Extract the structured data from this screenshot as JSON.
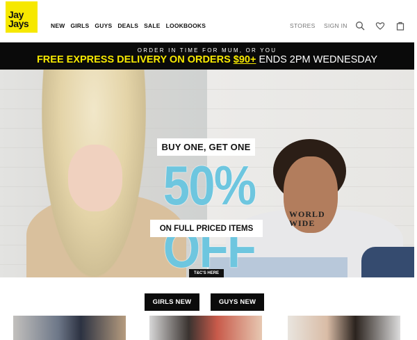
{
  "header": {
    "logo": {
      "line1": "Jay",
      "line2": "Jays",
      "color": "#f6e800"
    },
    "nav": [
      "NEW",
      "GIRLS",
      "GUYS",
      "DEALS",
      "SALE",
      "LOOKBOOKS"
    ],
    "stores": "STORES",
    "sign_in": "SIGN IN",
    "icons": [
      "search-icon",
      "heart-icon",
      "bag-icon"
    ]
  },
  "promo": {
    "small": "ORDER IN TIME FOR MUM, OR YOU",
    "part1": "FREE EXPRESS DELIVERY",
    "part2": " ON ORDERS ",
    "part3": "$90+",
    "part4": " ENDS 2PM WEDNESDAY",
    "accent": "#f6e800"
  },
  "hero": {
    "top_label": "BUY ONE, GET ONE",
    "big_label": "50% OFF",
    "bottom_label": "ON FULL PRICED ITEMS",
    "hoodie_line1": "WORLD",
    "hoodie_line2": "WIDE",
    "tcs": "T&C'S HERE",
    "accent": "#6ec6df"
  },
  "categories": {
    "girls": "GIRLS NEW",
    "guys": "GUYS NEW"
  }
}
